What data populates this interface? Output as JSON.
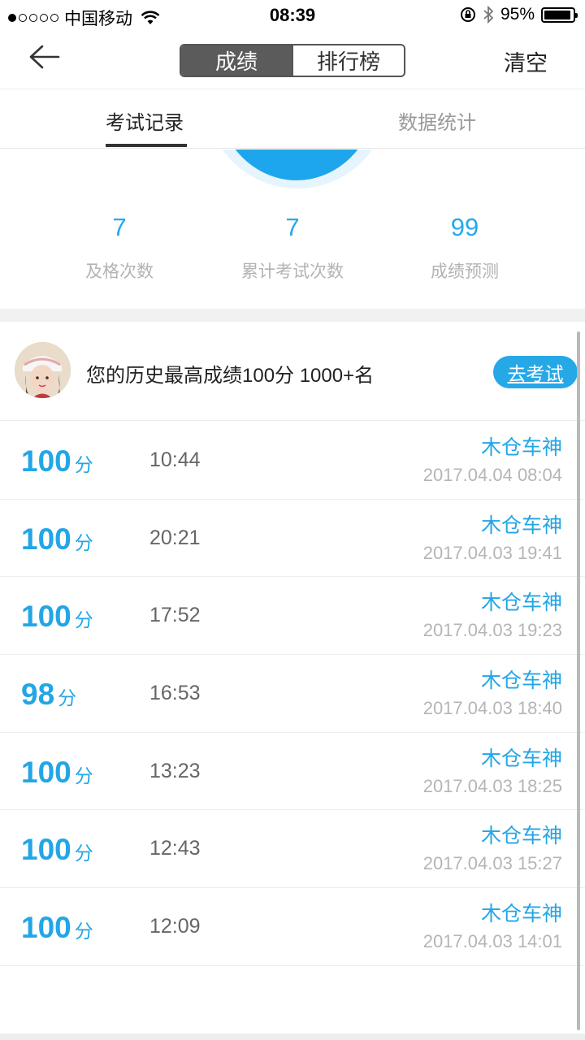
{
  "status_bar": {
    "carrier": "中国移动",
    "time": "08:39",
    "battery": "95%",
    "battery_level": 0.95
  },
  "nav": {
    "back_icon": "arrow-left-icon",
    "segments": [
      "成绩",
      "排行榜"
    ],
    "clear": "清空"
  },
  "tabs": [
    "考试记录",
    "数据统计"
  ],
  "stats": [
    {
      "value": "7",
      "label": "及格次数"
    },
    {
      "value": "7",
      "label": "累计考试次数"
    },
    {
      "value": "99",
      "label": "成绩预测"
    }
  ],
  "best": {
    "text": "您的历史最高成绩100分 1000+名",
    "button": "去考试"
  },
  "records": [
    {
      "score": "100",
      "unit": "分",
      "duration": "10:44",
      "user": "木仓车神",
      "date": "2017.04.04 08:04"
    },
    {
      "score": "100",
      "unit": "分",
      "duration": "20:21",
      "user": "木仓车神",
      "date": "2017.04.03 19:41"
    },
    {
      "score": "100",
      "unit": "分",
      "duration": "17:52",
      "user": "木仓车神",
      "date": "2017.04.03 19:23"
    },
    {
      "score": "98",
      "unit": "分",
      "duration": "16:53",
      "user": "木仓车神",
      "date": "2017.04.03 18:40"
    },
    {
      "score": "100",
      "unit": "分",
      "duration": "13:23",
      "user": "木仓车神",
      "date": "2017.04.03 18:25"
    },
    {
      "score": "100",
      "unit": "分",
      "duration": "12:43",
      "user": "木仓车神",
      "date": "2017.04.03 15:27"
    },
    {
      "score": "100",
      "unit": "分",
      "duration": "12:09",
      "user": "木仓车神",
      "date": "2017.04.03 14:01"
    }
  ],
  "colors": {
    "accent": "#23a6e6",
    "segment_active": "#5b5b5b"
  }
}
